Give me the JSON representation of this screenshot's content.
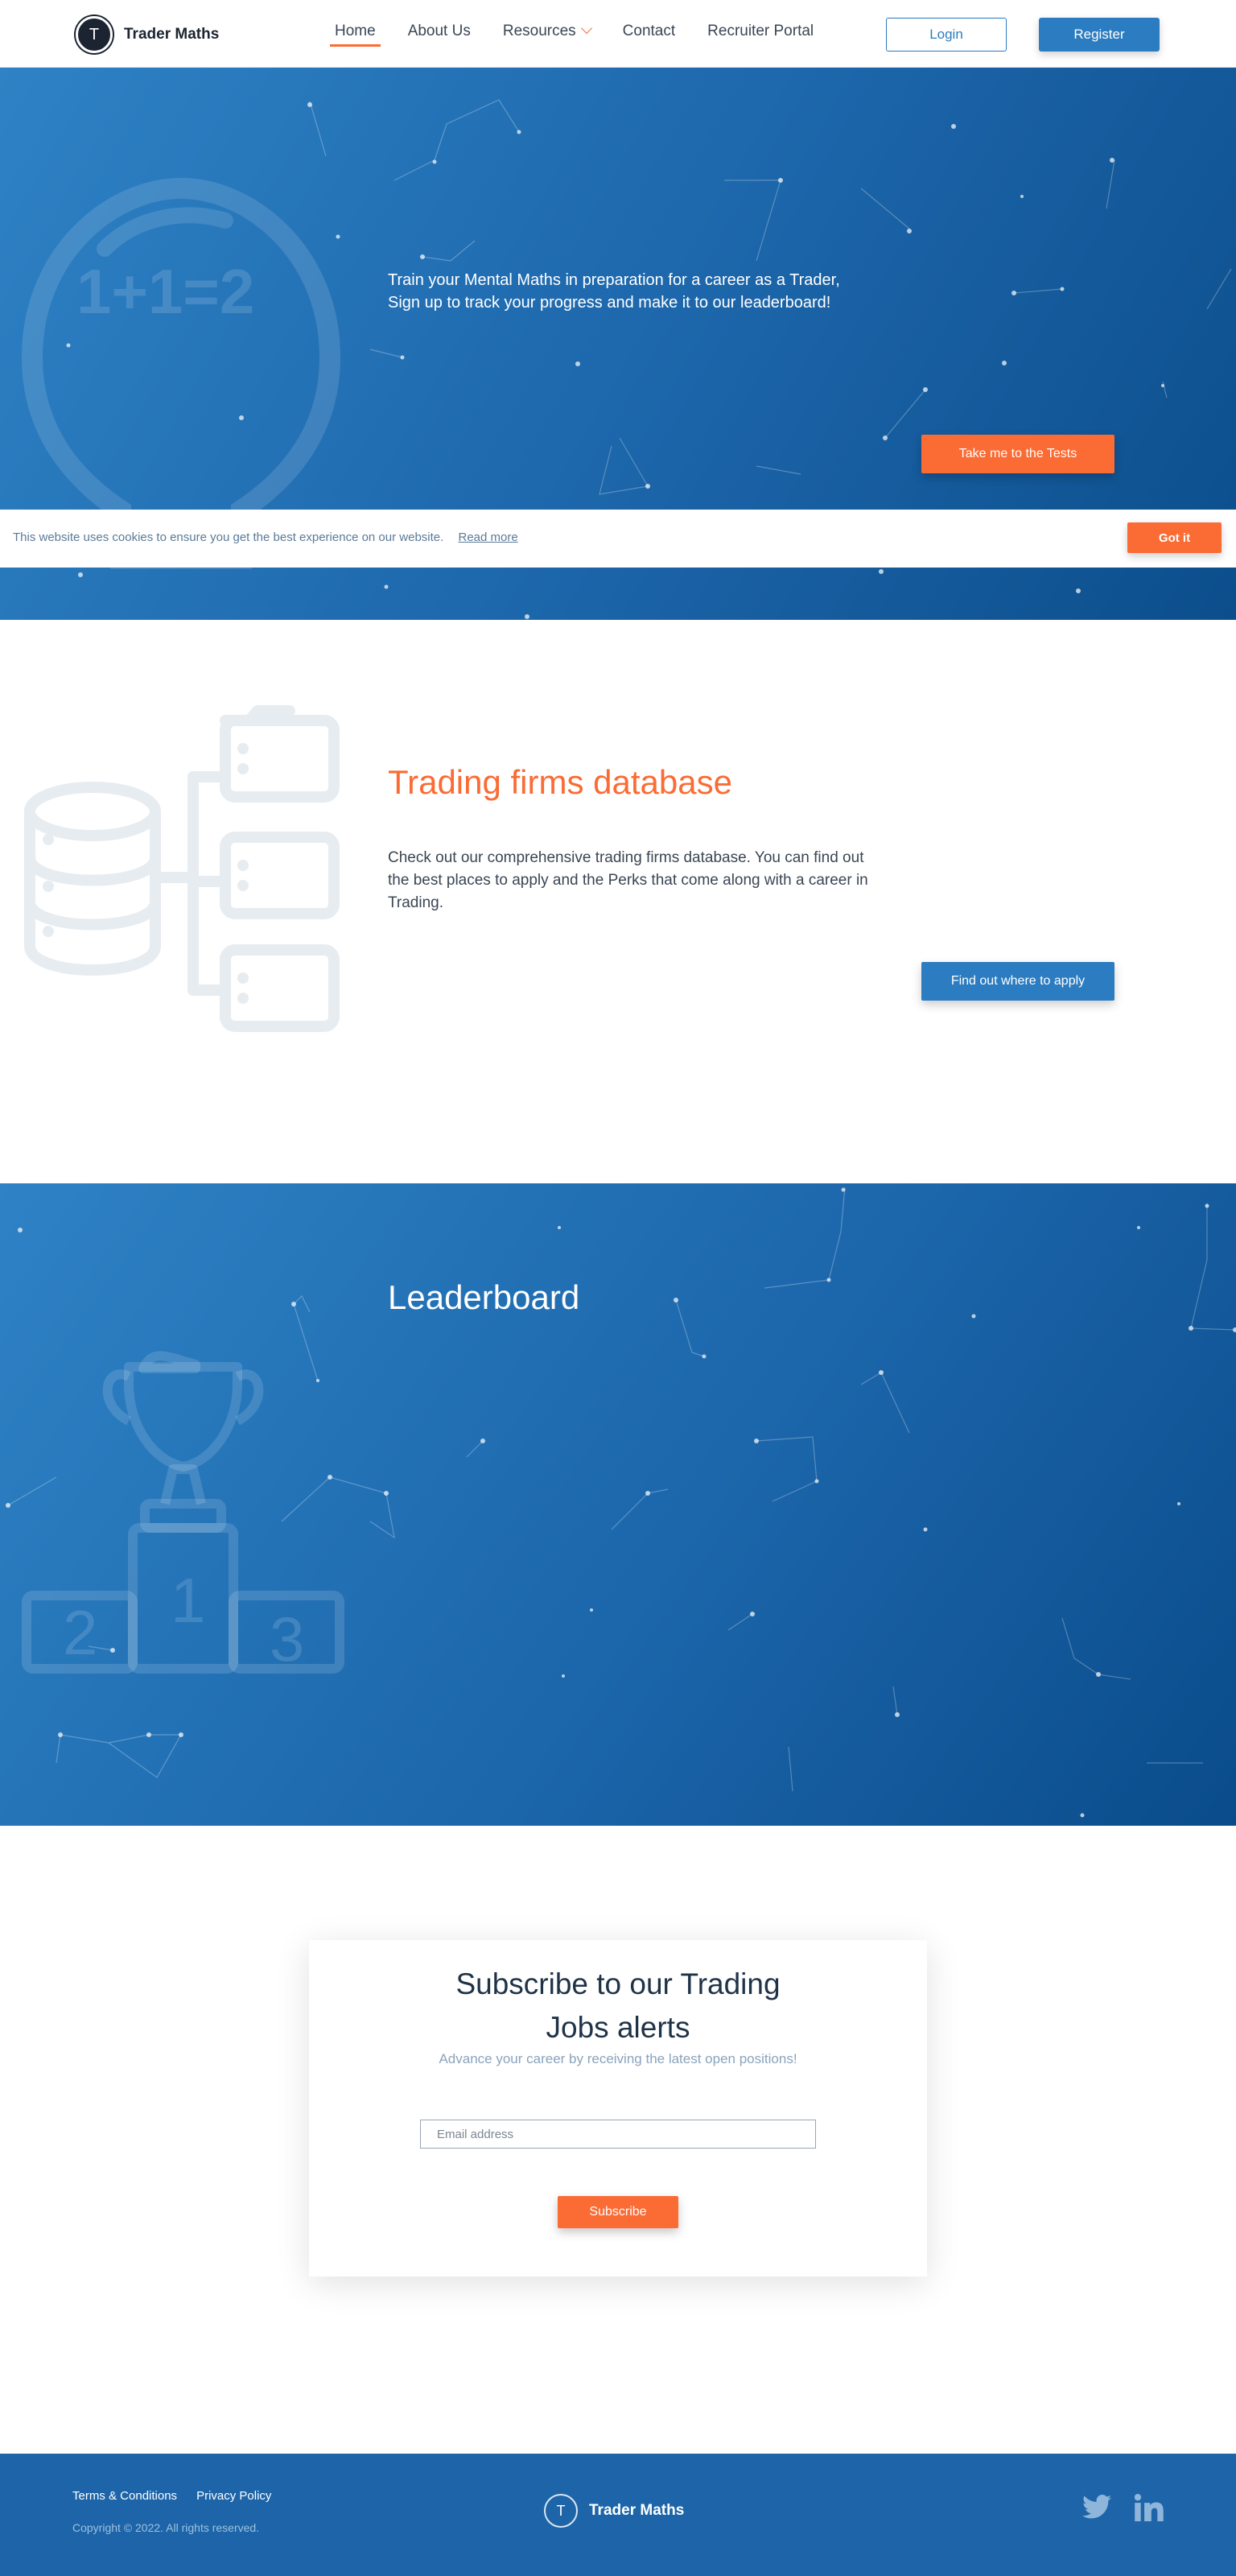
{
  "nav": {
    "brand": "Trader Maths",
    "logo_letter": "T",
    "items": [
      {
        "label": "Home",
        "active": true
      },
      {
        "label": "About Us"
      },
      {
        "label": "Resources",
        "dropdown": true
      },
      {
        "label": "Contact"
      },
      {
        "label": "Recruiter Portal"
      }
    ],
    "login": "Login",
    "register": "Register"
  },
  "hero": {
    "line1": "Train your Mental Maths in preparation for a career as a Trader,",
    "line2": "Sign up to track your progress and make it to our leaderboard!",
    "bulb_text": "1+1=2",
    "cta": "Take me to the Tests"
  },
  "cookie": {
    "message": "This website uses cookies to ensure you get the best experience on our website.",
    "link": "Read more",
    "button": "Got it"
  },
  "database": {
    "title": "Trading firms database",
    "body": "Check out our comprehensive trading firms database. You can find out the best places to apply and the Perks that come along with a career in Trading.",
    "cta": "Find out where to apply"
  },
  "leaderboard": {
    "title": "Leaderboard",
    "podium": [
      "2",
      "1",
      "3"
    ]
  },
  "subscribe": {
    "title": "Subscribe to our Trading Jobs alerts",
    "subtitle": "Advance your career by receiving the latest open positions!",
    "placeholder": "Email address",
    "button": "Subscribe"
  },
  "footer": {
    "terms": "Terms & Conditions",
    "privacy": "Privacy Policy",
    "copyright": "Copyright © 2022. All rights reserved.",
    "brand": "Trader Maths",
    "logo_letter": "T",
    "social": [
      "twitter-icon",
      "linkedin-icon"
    ]
  },
  "colors": {
    "brand_blue": "#2b7cc0",
    "accent_orange": "#fb6b34",
    "footer_blue": "#1d65a8"
  }
}
